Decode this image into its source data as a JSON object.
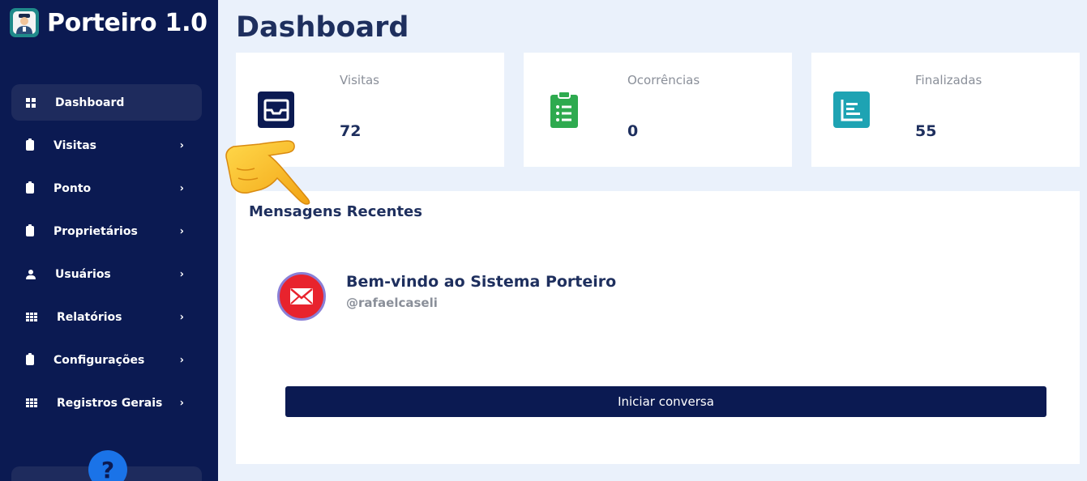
{
  "brand": {
    "title": "Porteiro 1.0",
    "logo_icon": "doorman-icon"
  },
  "sidebar": {
    "items": [
      {
        "label": "Dashboard",
        "icon": "grid-icon",
        "active": true,
        "has_submenu": false
      },
      {
        "label": "Visitas",
        "icon": "clipboard-icon",
        "has_submenu": true
      },
      {
        "label": "Ponto",
        "icon": "clipboard-icon",
        "has_submenu": true
      },
      {
        "label": "Proprietários",
        "icon": "clipboard-icon",
        "has_submenu": true
      },
      {
        "label": "Usuários",
        "icon": "user-icon",
        "has_submenu": true
      },
      {
        "label": "Relatórios",
        "icon": "table-icon",
        "has_submenu": true
      },
      {
        "label": "Configurações",
        "icon": "clipboard-icon",
        "has_submenu": true
      },
      {
        "label": "Registros Gerais",
        "icon": "table-icon",
        "has_submenu": true
      }
    ],
    "chevron": "›",
    "help_glyph": "?"
  },
  "page": {
    "title": "Dashboard"
  },
  "cards": [
    {
      "label": "Visitas",
      "value": "72",
      "icon": "inbox-icon",
      "color": "#0b1a52"
    },
    {
      "label": "Ocorrências",
      "value": "0",
      "icon": "clipboard-list-icon",
      "color": "#2eaa4f"
    },
    {
      "label": "Finalizadas",
      "value": "55",
      "icon": "chart-icon",
      "color": "#1ea3b3"
    }
  ],
  "messages": {
    "title": "Mensagens Recentes",
    "items": [
      {
        "title": "Bem-vindo ao Sistema Porteiro",
        "user": "@rafaelcaseli",
        "icon": "envelope-icon"
      }
    ],
    "button_label": "Iniciar conversa"
  },
  "colors": {
    "sidebar": "#0b1a52",
    "background": "#eaf1fb",
    "accent": "#1a73e8",
    "text_dark": "#1e2f5e"
  }
}
